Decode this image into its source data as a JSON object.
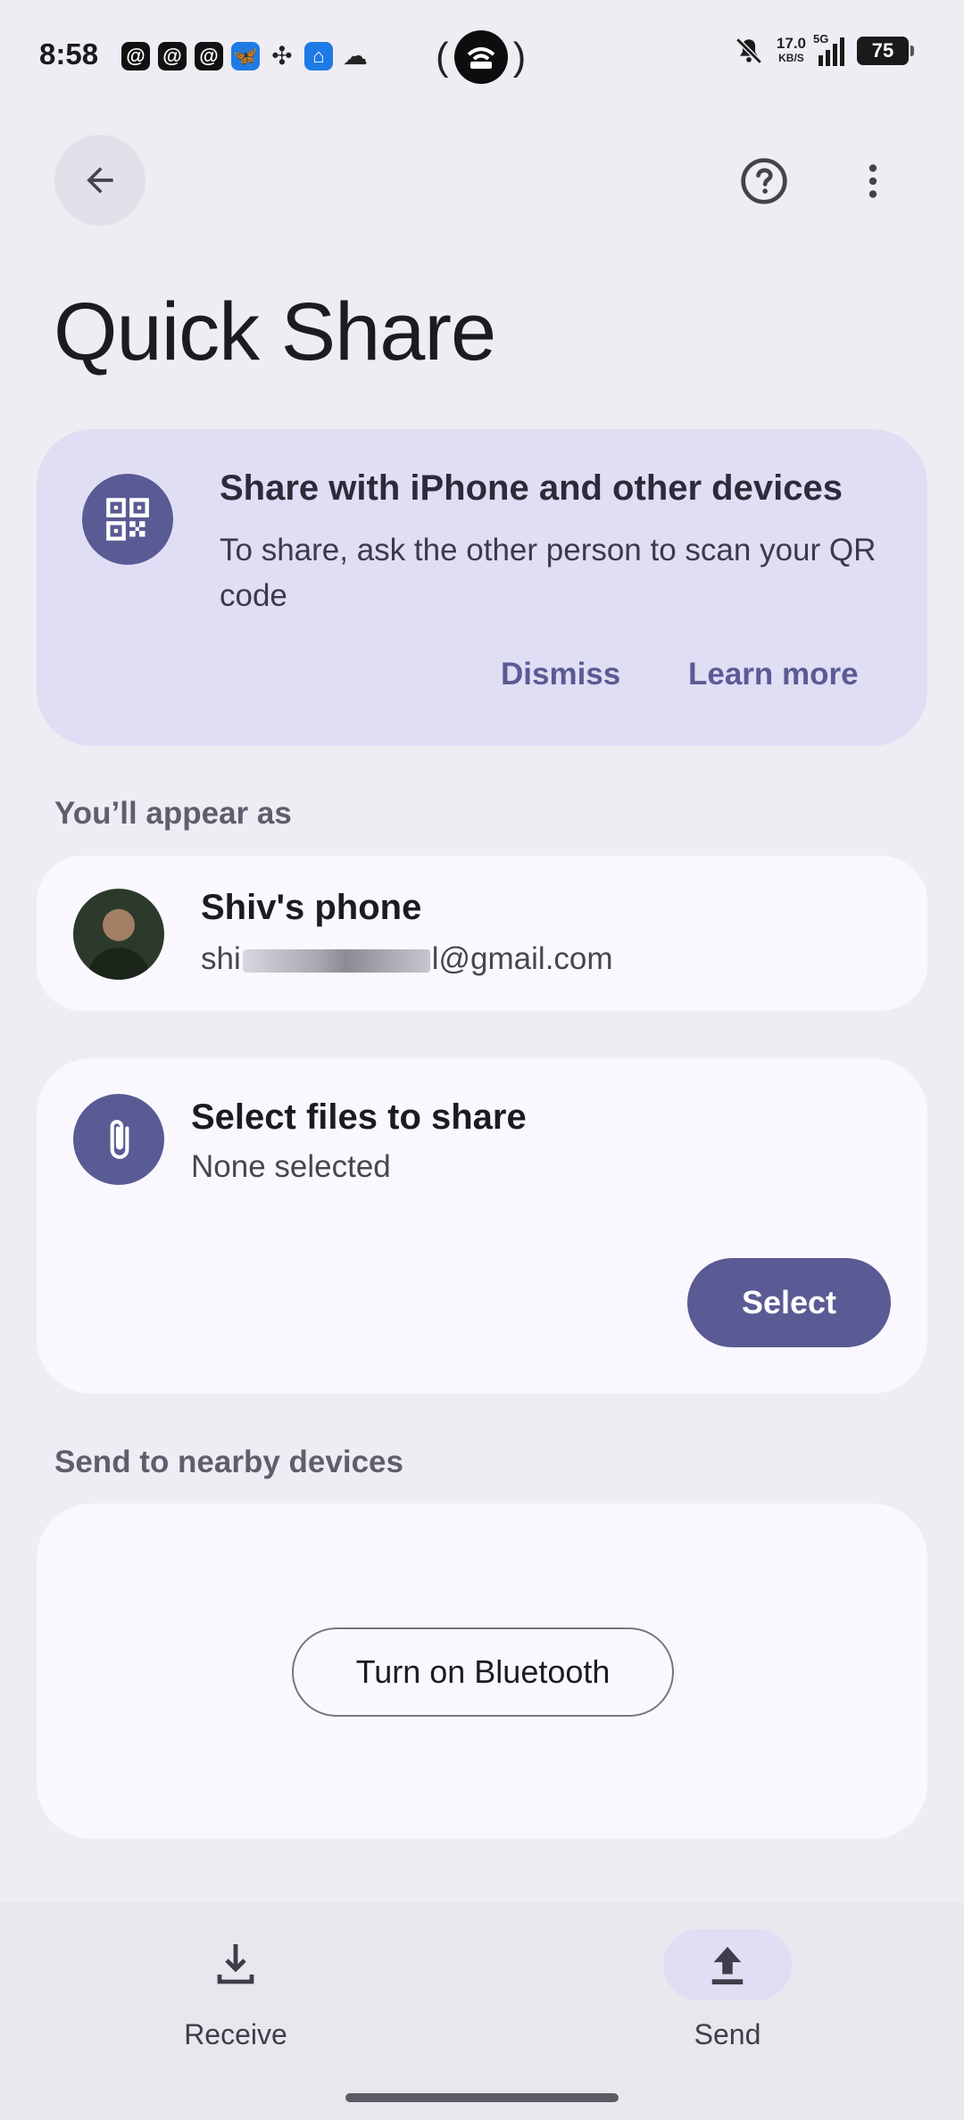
{
  "status_bar": {
    "time": "8:58",
    "network_speed": "17.0",
    "network_speed_unit": "KB/S",
    "network_type": "5G",
    "battery": "75"
  },
  "header": {
    "title": "Quick Share"
  },
  "promo": {
    "title": "Share with iPhone and other devices",
    "body": "To share, ask the other person to scan your QR code",
    "dismiss": "Dismiss",
    "learn_more": "Learn more"
  },
  "appear_as": {
    "label": "You’ll appear as",
    "device_name": "Shiv's phone",
    "email_prefix": "shi",
    "email_suffix": "l@gmail.com"
  },
  "files": {
    "title": "Select files to share",
    "subtitle": "None selected",
    "select_button": "Select"
  },
  "nearby": {
    "label": "Send to nearby devices",
    "bluetooth_button": "Turn on Bluetooth"
  },
  "bottom_nav": {
    "receive": "Receive",
    "send": "Send",
    "active": "send"
  },
  "colors": {
    "background": "#efedf4",
    "accent": "#5a5b94",
    "promo_background": "#dfdef5",
    "card_background": "#faf8fe"
  }
}
